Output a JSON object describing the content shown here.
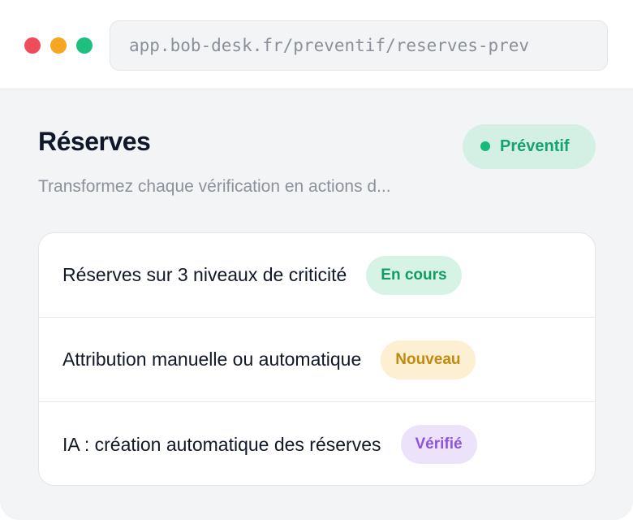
{
  "window": {
    "url": "app.bob-desk.fr/preventif/reserves-prev"
  },
  "header": {
    "title": "Réserves",
    "badge": "Préventif",
    "subtitle": "Transformez chaque vérification en actions d..."
  },
  "items": [
    {
      "label": "Réserves sur 3 niveaux de criticité",
      "status": "En cours"
    },
    {
      "label": "Attribution manuelle ou automatique",
      "status": "Nouveau"
    },
    {
      "label": "IA : création automatique des réserves",
      "status": "Vérifié"
    }
  ],
  "colors": {
    "accent_green": "#17a370",
    "status_yellow": "#c38a12",
    "status_purple": "#8b55dc"
  }
}
